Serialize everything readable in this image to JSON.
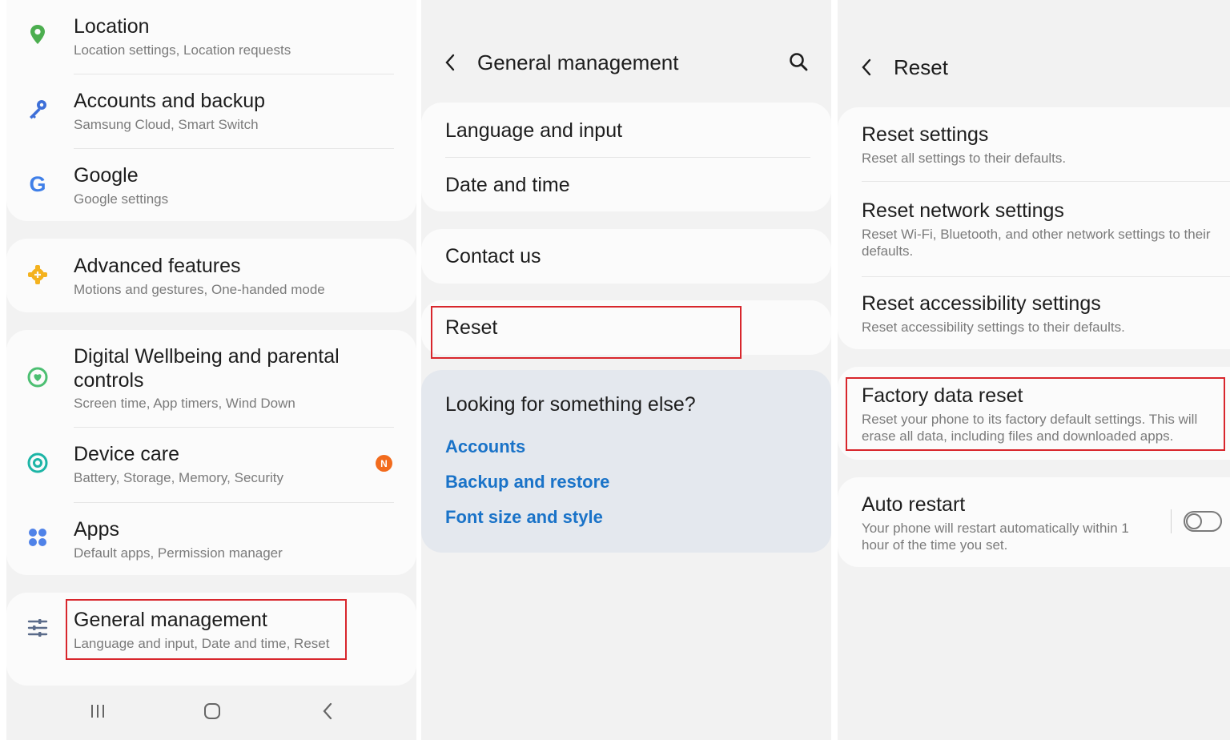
{
  "settings": {
    "items": [
      {
        "title": "Location",
        "sub": "Location settings, Location requests"
      },
      {
        "title": "Accounts and backup",
        "sub": "Samsung Cloud, Smart Switch"
      },
      {
        "title": "Google",
        "sub": "Google settings"
      },
      {
        "title": "Advanced features",
        "sub": "Motions and gestures, One-handed mode"
      },
      {
        "title": "Digital Wellbeing and parental controls",
        "sub": "Screen time, App timers, Wind Down"
      },
      {
        "title": "Device care",
        "sub": "Battery, Storage, Memory, Security",
        "badge": "N"
      },
      {
        "title": "Apps",
        "sub": "Default apps, Permission manager"
      },
      {
        "title": "General management",
        "sub": "Language and input, Date and time, Reset"
      }
    ]
  },
  "general": {
    "header": "General management",
    "items": [
      "Language and input",
      "Date and time",
      "Contact us",
      "Reset"
    ],
    "suggest_title": "Looking for something else?",
    "links": [
      "Accounts",
      "Backup and restore",
      "Font size and style"
    ]
  },
  "reset": {
    "header": "Reset",
    "items": [
      {
        "title": "Reset settings",
        "sub": "Reset all settings to their defaults."
      },
      {
        "title": "Reset network settings",
        "sub": "Reset Wi-Fi, Bluetooth, and other network settings to their defaults."
      },
      {
        "title": "Reset accessibility settings",
        "sub": "Reset accessibility settings to their defaults."
      },
      {
        "title": "Factory data reset",
        "sub": "Reset your phone to its factory default settings. This will erase all data, including files and downloaded apps."
      },
      {
        "title": "Auto restart",
        "sub": "Your phone will restart automatically within 1 hour of the time you set."
      }
    ]
  },
  "colors": {
    "highlight": "#d8262c",
    "link": "#1a73c8",
    "badge": "#f26b1d"
  }
}
